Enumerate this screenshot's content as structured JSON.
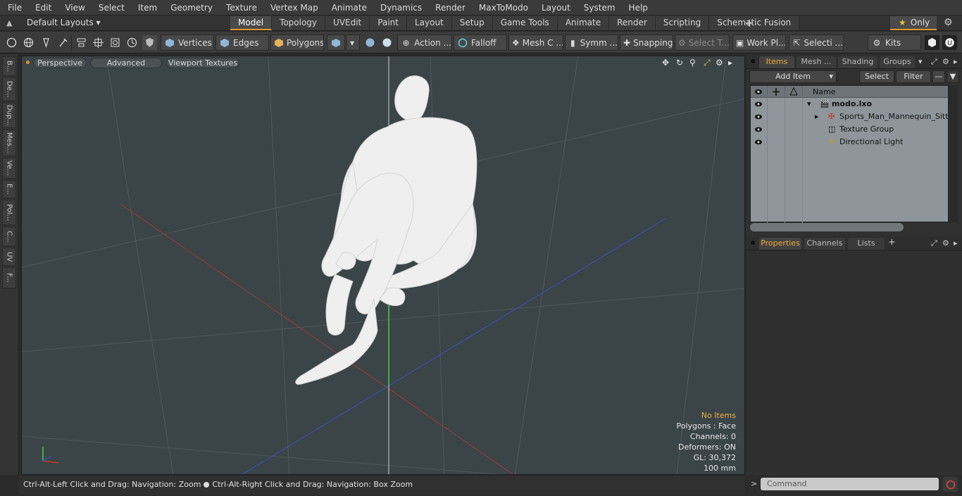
{
  "menu": [
    "File",
    "Edit",
    "View",
    "Select",
    "Item",
    "Geometry",
    "Texture",
    "Vertex Map",
    "Animate",
    "Dynamics",
    "Render",
    "MaxToModo",
    "Layout",
    "System",
    "Help"
  ],
  "layout": {
    "name": "Default Layouts ▾",
    "tabs": [
      "Model",
      "Topology",
      "UVEdit",
      "Paint",
      "Layout",
      "Setup",
      "Game Tools",
      "Animate",
      "Render",
      "Scripting",
      "Schematic Fusion"
    ],
    "active_tab": "Model",
    "add_tab": "+",
    "only_label": "Only"
  },
  "toolbar": {
    "vertices": "Vertices",
    "edges": "Edges",
    "polygons": "Polygons",
    "action": "Action ...",
    "falloff": "Falloff",
    "mesh_c": "Mesh C ...",
    "symm": "Symm ...",
    "snapping": "Snapping",
    "select_t": "Select T...",
    "work_pl": "Work Pl...",
    "selecti": "Selecti ...",
    "kits": "Kits"
  },
  "left_tabs": [
    "B...",
    "De...",
    "Dup...",
    "Mes...",
    "Ve...",
    "E...",
    "Pol...",
    "C...",
    "UV",
    "F..."
  ],
  "viewport": {
    "view_mode": "Perspective",
    "shading": "Advanced",
    "textures": "Viewport Textures",
    "info": {
      "selection": "No Items",
      "polygons": "Polygons : Face",
      "channels": "Channels: 0",
      "deformers": "Deformers: ON",
      "gl": "GL: 30,372",
      "scale": "100 mm"
    }
  },
  "status": {
    "left": "Ctrl-Alt-Left Click and Drag: Navigation: Zoom",
    "right": "Ctrl-Alt-Right Click and Drag: Navigation: Box Zoom"
  },
  "items_panel": {
    "tabs": [
      "Items",
      "Mesh ...",
      "Shading",
      "Groups"
    ],
    "add_item": "Add Item",
    "select": "Select",
    "filter": "Filter",
    "name_col": "Name",
    "tree": [
      {
        "name": "modo.lxo",
        "bold": true
      },
      {
        "name": "Sports_Man_Mannequin_Sitti ..."
      },
      {
        "name": "Texture Group"
      },
      {
        "name": "Directional Light"
      }
    ]
  },
  "properties_panel": {
    "tabs": [
      "Properties",
      "Channels",
      "Lists"
    ],
    "add": "+"
  },
  "command": {
    "prompt": ">",
    "placeholder": "Command"
  },
  "colors": {
    "accent": "#e39a2d",
    "viewport_bg": "#3b4446",
    "tree_bg": "#8e969b",
    "axis_x": "#c0392b",
    "axis_z": "#3a4fd8",
    "axis_y": "#2ecc40"
  }
}
